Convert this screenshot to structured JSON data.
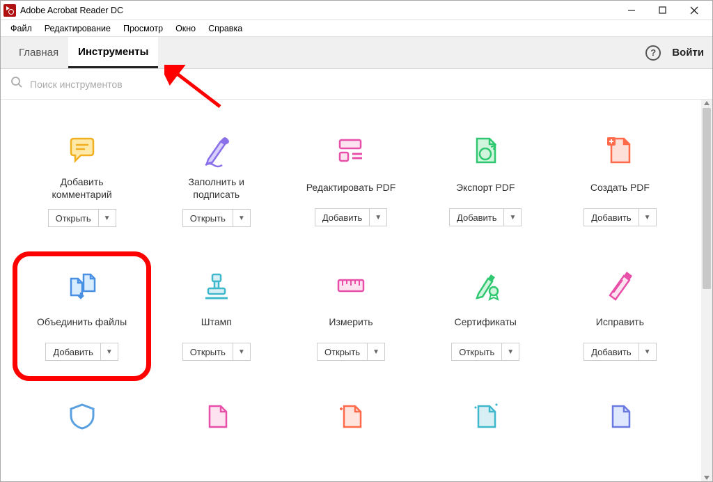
{
  "window": {
    "title": "Adobe Acrobat Reader DC"
  },
  "menu": {
    "items": [
      "Файл",
      "Редактирование",
      "Просмотр",
      "Окно",
      "Справка"
    ]
  },
  "tabs": {
    "home": "Главная",
    "tools": "Инструменты",
    "signin": "Войти"
  },
  "search": {
    "placeholder": "Поиск инструментов"
  },
  "buttons": {
    "open": "Открыть",
    "add": "Добавить"
  },
  "tools": [
    {
      "label": "Добавить комментарий",
      "action": "open",
      "icon": "comment"
    },
    {
      "label": "Заполнить и подписать",
      "action": "open",
      "icon": "fill-sign"
    },
    {
      "label": "Редактировать PDF",
      "action": "add",
      "icon": "edit-pdf"
    },
    {
      "label": "Экспорт PDF",
      "action": "add",
      "icon": "export-pdf"
    },
    {
      "label": "Создать PDF",
      "action": "add",
      "icon": "create-pdf"
    },
    {
      "label": "Объединить файлы",
      "action": "add",
      "icon": "combine",
      "highlight": true
    },
    {
      "label": "Штамп",
      "action": "open",
      "icon": "stamp"
    },
    {
      "label": "Измерить",
      "action": "open",
      "icon": "measure"
    },
    {
      "label": "Сертификаты",
      "action": "open",
      "icon": "certificates"
    },
    {
      "label": "Исправить",
      "action": "add",
      "icon": "redact"
    }
  ]
}
